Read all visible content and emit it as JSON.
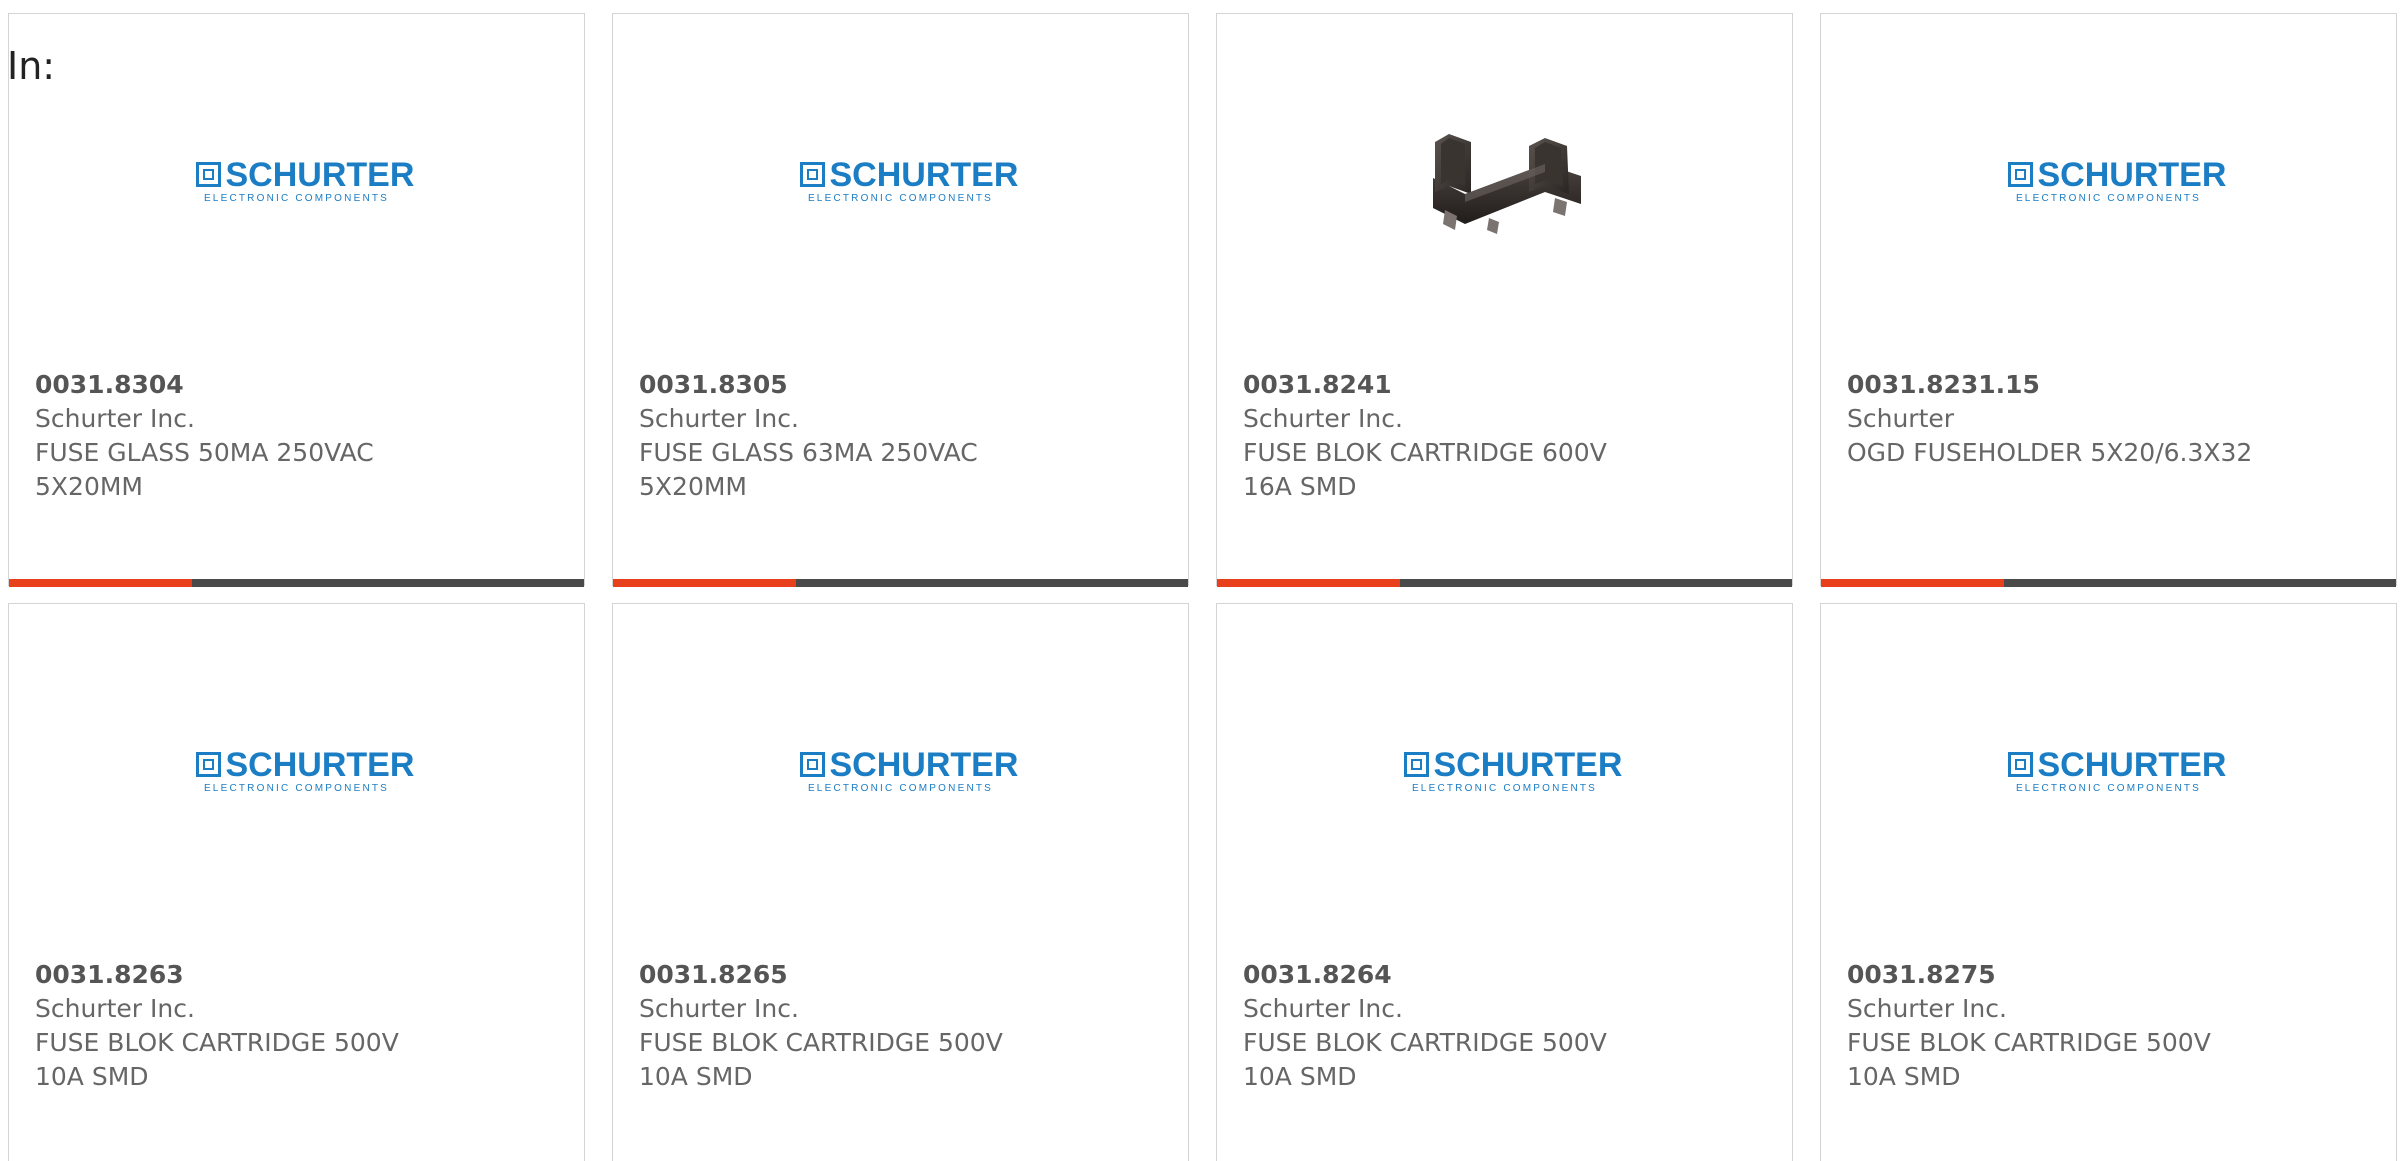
{
  "prefix_label": "In:",
  "colors": {
    "accent": "#e8401c",
    "bar": "#4a4a4a",
    "logo_blue": "#1b7dc4"
  },
  "logo": {
    "word": "SCHURTER",
    "sub": "ELECTRONIC COMPONENTS"
  },
  "products": [
    {
      "part": "0031.8304",
      "maker": "Schurter Inc.",
      "line1": "FUSE GLASS 50MA 250VAC",
      "line2": "5X20MM",
      "image": "schurter-logo"
    },
    {
      "part": "0031.8305",
      "maker": "Schurter Inc.",
      "line1": "FUSE GLASS 63MA 250VAC",
      "line2": "5X20MM",
      "image": "schurter-logo"
    },
    {
      "part": "0031.8241",
      "maker": "Schurter Inc.",
      "line1": "FUSE BLOK CARTRIDGE 600V",
      "line2": "16A SMD",
      "image": "fuse-holder-photo"
    },
    {
      "part": "0031.8231.15",
      "maker": "Schurter",
      "line1": "OGD FUSEHOLDER 5X20/6.3X32",
      "line2": "",
      "image": "schurter-logo"
    },
    {
      "part": "0031.8263",
      "maker": "Schurter Inc.",
      "line1": "FUSE BLOK CARTRIDGE 500V",
      "line2": "10A SMD",
      "image": "schurter-logo"
    },
    {
      "part": "0031.8265",
      "maker": "Schurter Inc.",
      "line1": "FUSE BLOK CARTRIDGE 500V",
      "line2": "10A SMD",
      "image": "schurter-logo"
    },
    {
      "part": "0031.8264",
      "maker": "Schurter Inc.",
      "line1": "FUSE BLOK CARTRIDGE 500V",
      "line2": "10A SMD",
      "image": "schurter-logo"
    },
    {
      "part": "0031.8275",
      "maker": "Schurter Inc.",
      "line1": "FUSE BLOK CARTRIDGE 500V",
      "line2": "10A SMD",
      "image": "schurter-logo"
    }
  ]
}
